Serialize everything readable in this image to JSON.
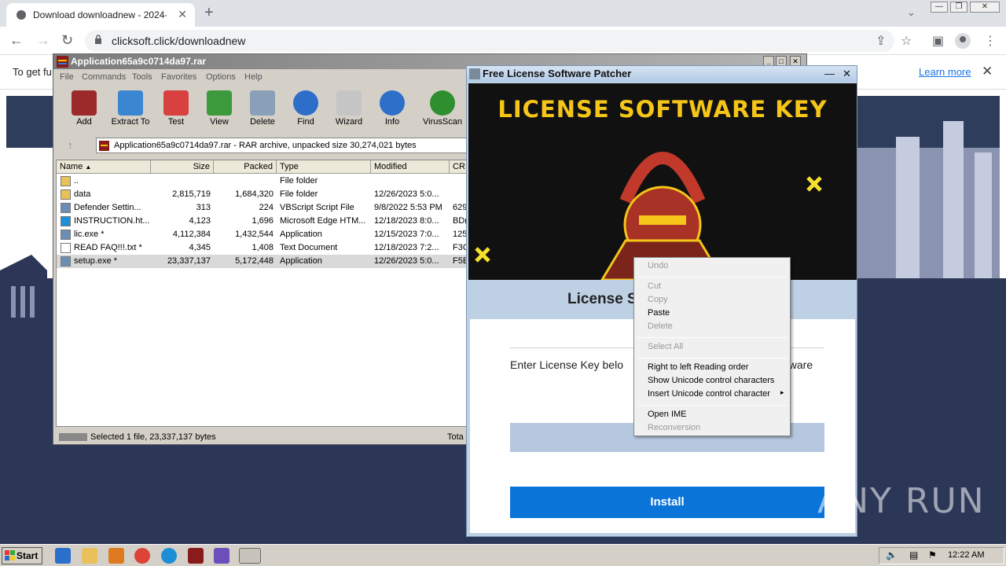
{
  "chrome": {
    "tab_title": "Download downloadnew - 2024-01-",
    "url": "clicksoft.click/downloadnew",
    "infobar_text": "To get fu",
    "learn_more": "Learn more"
  },
  "winrar": {
    "title": "Application65a9c0714da97.rar",
    "menu": [
      "File",
      "Commands",
      "Tools",
      "Favorites",
      "Options",
      "Help"
    ],
    "tools": [
      "Add",
      "Extract To",
      "Test",
      "View",
      "Delete",
      "Find",
      "Wizard",
      "Info",
      "VirusScan"
    ],
    "path_text": "Application65a9c0714da97.rar - RAR archive, unpacked size 30,274,021 bytes",
    "columns": [
      "Name",
      "Size",
      "Packed",
      "Type",
      "Modified",
      "CR"
    ],
    "rows": [
      {
        "name": "..",
        "size": "",
        "packed": "",
        "type": "File folder",
        "modified": "",
        "crc": ""
      },
      {
        "name": "data",
        "size": "2,815,719",
        "packed": "1,684,320",
        "type": "File folder",
        "modified": "12/26/2023 5:0...",
        "crc": ""
      },
      {
        "name": "Defender   Settin...",
        "size": "313",
        "packed": "224",
        "type": "VBScript Script File",
        "modified": "9/8/2022 5:53 PM",
        "crc": "629"
      },
      {
        "name": "INSTRUCTION.ht...",
        "size": "4,123",
        "packed": "1,696",
        "type": "Microsoft Edge HTM...",
        "modified": "12/18/2023 8:0...",
        "crc": "BD("
      },
      {
        "name": "lic.exe *",
        "size": "4,112,384",
        "packed": "1,432,544",
        "type": "Application",
        "modified": "12/15/2023 7:0...",
        "crc": "125"
      },
      {
        "name": "READ FAQ!!!.txt *",
        "size": "4,345",
        "packed": "1,408",
        "type": "Text Document",
        "modified": "12/18/2023 7:2...",
        "crc": "F3C"
      },
      {
        "name": "setup.exe *",
        "size": "23,337,137",
        "packed": "5,172,448",
        "type": "Application",
        "modified": "12/26/2023 5:0...",
        "crc": "F5E"
      }
    ],
    "status": "Selected 1 file, 23,337,137 bytes",
    "status_right": "Tota"
  },
  "patcher": {
    "title": "Free License Software Patcher",
    "banner": "LICENSE SOFTWARE KEY",
    "subtitle": "License S",
    "prompt": "Enter License Key belo",
    "prompt_tail": "ftware",
    "install": "Install"
  },
  "context_menu": {
    "undo": "Undo",
    "cut": "Cut",
    "copy": "Copy",
    "paste": "Paste",
    "delete": "Delete",
    "select_all": "Select All",
    "rtl": "Right to left Reading order",
    "show_unicode": "Show Unicode control characters",
    "insert_unicode": "Insert Unicode control character",
    "open_ime": "Open IME",
    "reconversion": "Reconversion"
  },
  "taskbar": {
    "start": "Start",
    "clock": "12:22 AM"
  },
  "watermark": "ANY RUN"
}
